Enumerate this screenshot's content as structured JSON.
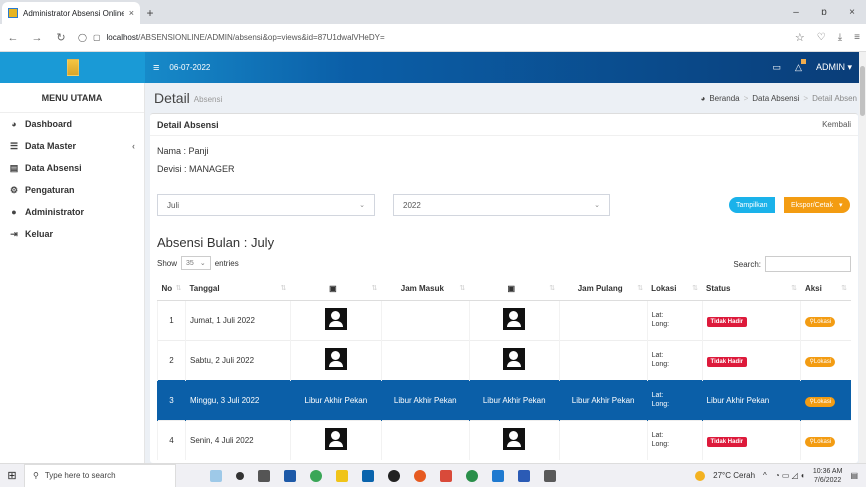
{
  "browser": {
    "tab_title": "Administrator Absensi Online V",
    "tab_close": "×",
    "new_tab": "+",
    "url_host": "localhost",
    "url_path": "/ABSENSIONLINE/ADMIN/absensi&op=views&id=87U1dwalVHeDY=",
    "win_minimize": "–",
    "win_restore": "ɒ",
    "win_close": "×"
  },
  "header": {
    "date": "06-07-2022",
    "user": "ADMIN ▾"
  },
  "sidebar": {
    "title": "MENU UTAMA",
    "items": [
      {
        "label": "Dashboard",
        "icon": "tachometer-icon"
      },
      {
        "label": "Data Master",
        "icon": "database-icon",
        "chevron": "‹"
      },
      {
        "label": "Data Absensi",
        "icon": "list-icon"
      },
      {
        "label": "Pengaturan",
        "icon": "gears-icon"
      },
      {
        "label": "Administrator",
        "icon": "user-icon"
      },
      {
        "label": "Keluar",
        "icon": "logout-icon"
      }
    ]
  },
  "page": {
    "title": "Detail",
    "subtitle": "Absensi",
    "breadcrumb": [
      "Beranda",
      "Data Absensi",
      "Detail Absen"
    ]
  },
  "detail": {
    "box_title": "Detail Absensi",
    "back": "Kembali",
    "nama": "Nama : Panji",
    "devisi": "Devisi : MANAGER",
    "month_select": "Juli",
    "year_select": "2022",
    "btn_show": "Tampilkan",
    "btn_export": "Ekspor/Cetak",
    "month_title": "Absensi Bulan : July",
    "show_label": "Show",
    "entries_value": "35",
    "entries_label": "entries",
    "search_label": "Search:"
  },
  "table": {
    "headers": [
      "No",
      "Tanggal",
      "",
      "Jam Masuk",
      "",
      "Jam Pulang",
      "Lokasi",
      "Status",
      "Aksi"
    ],
    "rows": [
      {
        "no": "1",
        "tanggal": "Jumat, 1 Juli 2022",
        "lat": "Lat:",
        "long": "Long:",
        "status": "Tidak Hadir",
        "aksi": "Lokasi",
        "weekend": false
      },
      {
        "no": "2",
        "tanggal": "Sabtu, 2 Juli 2022",
        "lat": "Lat:",
        "long": "Long:",
        "status": "Tidak Hadir",
        "aksi": "Lokasi",
        "weekend": false
      },
      {
        "no": "3",
        "tanggal": "Minggu, 3 Juli 2022",
        "lat": "Lat:",
        "long": "Long:",
        "status": "Libur Akhir Pekan",
        "aksi": "Lokasi",
        "weekend": true,
        "weekend_text": "Libur Akhir Pekan"
      },
      {
        "no": "4",
        "tanggal": "Senin, 4 Juli 2022",
        "lat": "Lat:",
        "long": "Long:",
        "status": "Tidak Hadir",
        "aksi": "Lokasi",
        "weekend": false
      }
    ]
  },
  "taskbar": {
    "search_placeholder": "Type here to search",
    "weather": "27°C Cerah",
    "time": "10:36 AM",
    "date": "7/6/2022"
  },
  "colors": {
    "header_gradient_start": "#1fa9e1",
    "header_gradient_end": "#0a3d78",
    "weekend_row": "#0b5fa8",
    "badge_red": "#dd1a3b",
    "badge_orange": "#f39c12",
    "btn_blue": "#1ab2ea"
  }
}
